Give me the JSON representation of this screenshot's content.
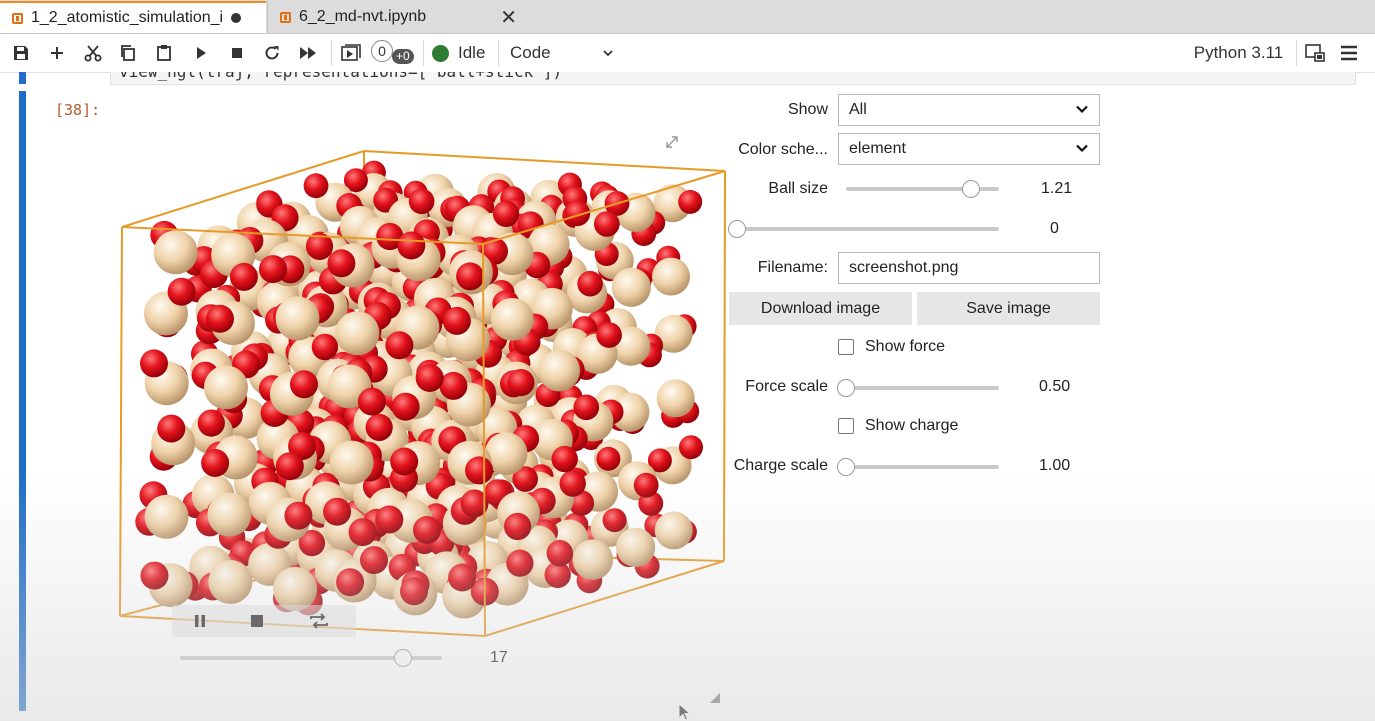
{
  "tabs": [
    {
      "label": "1_2_atomistic_simulation_i",
      "active": true,
      "dirty": true
    },
    {
      "label": "6_2_md-nvt.ipynb",
      "active": false,
      "close": "✕"
    }
  ],
  "toolbar": {
    "icons": [
      "save-icon",
      "add-icon",
      "cut-icon",
      "copy-icon",
      "paste-icon",
      "run-icon",
      "stop-icon",
      "restart-icon",
      "fast-forward-icon",
      "present-icon"
    ],
    "exec_count": "0",
    "exec_badge": "+0",
    "kernel_status": "Idle",
    "cell_type": "Code",
    "kernel_name": "Python 3.11",
    "kernel_color": "#2e7d32"
  },
  "cell": {
    "code_fragment": "view_ngl(traj, representations=[\"ball+stick\"])",
    "prompt": "[38]:"
  },
  "widget": {
    "show_label": "Show",
    "show_value": "All",
    "color_label": "Color sche...",
    "color_value": "element",
    "ball_size_label": "Ball size",
    "ball_size_value": "1.21",
    "ball_size_fraction": 0.82,
    "opacity_value": "0",
    "opacity_fraction": 0.0,
    "filename_label": "Filename:",
    "filename_value": "screenshot.png",
    "download_button": "Download image",
    "save_button": "Save image",
    "show_force_label": "Show force",
    "force_scale_label": "Force scale",
    "force_scale_value": "0.50",
    "force_scale_fraction": 0.0,
    "show_charge_label": "Show charge",
    "charge_scale_label": "Charge scale",
    "charge_scale_value": "1.00",
    "charge_scale_fraction": 0.0
  },
  "player": {
    "frame_value": "17",
    "frame_fraction": 0.85
  },
  "colors": {
    "accent_tab": "#f28a22",
    "cell_bar": "#1f6dc7",
    "oxygen": "#e8101a",
    "cation": "#f1d2a8",
    "box_edge": "#e69a28"
  }
}
